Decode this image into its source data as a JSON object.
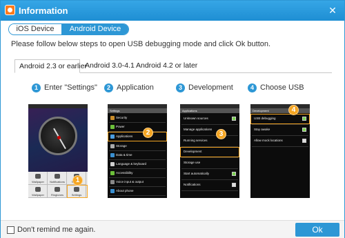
{
  "window": {
    "title": "Information",
    "close_glyph": "✕"
  },
  "device_tabs": [
    {
      "label": "iOS Device",
      "active": false
    },
    {
      "label": "Android Device",
      "active": true
    }
  ],
  "instruction": "Please follow below steps to open USB debugging mode and click Ok button.",
  "version_tabs": [
    {
      "label": "Android 2.3 or earlier",
      "active": true
    },
    {
      "label": "Android 3.0-4.1",
      "active": false
    },
    {
      "label": "Android 4.2 or later",
      "active": false
    }
  ],
  "steps": [
    {
      "number": "1",
      "label": "Enter \"Settings\""
    },
    {
      "number": "2",
      "label": "Application"
    },
    {
      "number": "3",
      "label": "Development"
    },
    {
      "number": "4",
      "label": "Choose USB"
    }
  ],
  "phone1": {
    "menu": [
      "Wallpaper",
      "Notifications",
      "Settings",
      "Wallpaper",
      "Ringtones",
      "Settings"
    ],
    "badge": "1"
  },
  "phone2": {
    "header": "Settings",
    "rows": [
      "Security",
      "Power",
      "Applications",
      "Storage",
      "Data & time",
      "Language & keyboard",
      "Accessibility",
      "Voice input & output",
      "About phone"
    ],
    "badge": "2"
  },
  "phone3": {
    "header": "Applications",
    "rows": [
      "Unknown sources",
      "Manage applications",
      "Running services",
      "Development",
      "Storage use",
      "Start automatically",
      "Notifications"
    ],
    "badge": "3"
  },
  "phone4": {
    "header": "Development",
    "rows": [
      "USB debugging",
      "Stay awake",
      "Allow mock locations"
    ],
    "badge": "4"
  },
  "footer": {
    "remind_label": "Don't remind me again.",
    "ok_label": "Ok"
  },
  "colors": {
    "accent": "#2d97d5",
    "highlight": "#f5a623"
  }
}
